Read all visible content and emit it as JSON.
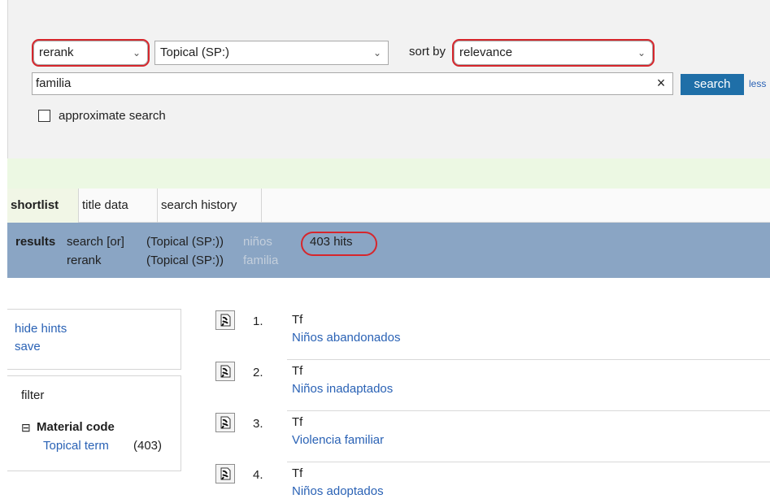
{
  "search": {
    "mode": "rerank",
    "index": "Topical (SP:)",
    "sort_by_label": "sort by",
    "sort": "relevance",
    "query": "familia",
    "clear_glyph": "×",
    "button": "search",
    "less_link": "less",
    "approx_label": "approximate search",
    "approx_checked": false
  },
  "tabs": [
    {
      "label": "shortlist",
      "active": true
    },
    {
      "label": "title data",
      "active": false
    },
    {
      "label": "search history",
      "active": false
    }
  ],
  "results_bar": {
    "label": "results",
    "line1": {
      "op": "search [or]",
      "index": "(Topical (SP:))",
      "term": "niños"
    },
    "hits": "403 hits",
    "line2": {
      "op": "rerank",
      "index": "(Topical (SP:))",
      "term": "familia"
    }
  },
  "hints": {
    "hide": "hide hints",
    "save": "save"
  },
  "filter": {
    "label": "filter",
    "toggle_glyph": "⊟",
    "group": "Material code",
    "item_label": "Topical term",
    "item_count": "(403)"
  },
  "results": [
    {
      "num": "1.",
      "type": "Tf",
      "title": "Niños abandonados"
    },
    {
      "num": "2.",
      "type": "Tf",
      "title": "Niños inadaptados"
    },
    {
      "num": "3.",
      "type": "Tf",
      "title": "Violencia familiar"
    },
    {
      "num": "4.",
      "type": "Tf",
      "title": "Niños adoptados"
    }
  ],
  "colors": {
    "accent_blue": "#1f6fa8",
    "link_blue": "#2a62b5",
    "results_bar": "#8aa5c4",
    "highlight_red": "#d6262c",
    "green_band": "#ecf8e3"
  },
  "icons": {
    "result_record": "record-icon",
    "dropdown": "chevron-down-icon",
    "clear": "close-icon"
  }
}
